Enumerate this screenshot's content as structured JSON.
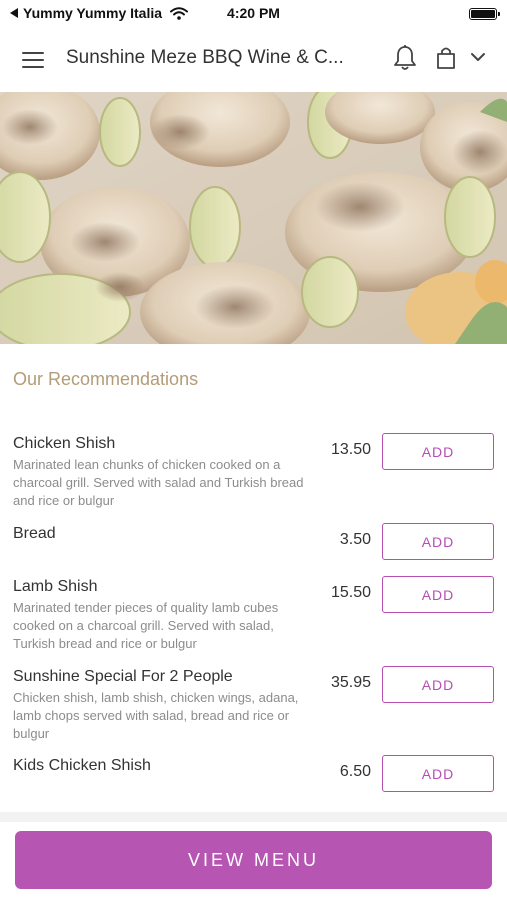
{
  "status_bar": {
    "back_label": "Yummy Yummy Italia",
    "time": "4:20 PM"
  },
  "header": {
    "title": "Sunshine Meze BBQ Wine & C..."
  },
  "section": {
    "title": "Our Recommendations"
  },
  "items": [
    {
      "name": "Chicken Shish",
      "description": "Marinated lean chunks of chicken cooked on a charcoal grill. Served with salad and Turkish bread and rice or bulgur",
      "price": "13.50",
      "add_label": "ADD"
    },
    {
      "name": "Bread",
      "description": "",
      "price": "3.50",
      "add_label": "ADD"
    },
    {
      "name": "Lamb Shish",
      "description": "Marinated tender pieces of quality lamb cubes cooked on a charcoal grill. Served with salad, Turkish bread and rice or bulgur",
      "price": "15.50",
      "add_label": "ADD"
    },
    {
      "name": "Sunshine Special For 2 People",
      "description": "Chicken shish, lamb shish, chicken wings, adana, lamb chops served with salad, bread and rice or bulgur",
      "price": "35.95",
      "add_label": "ADD"
    },
    {
      "name": "Kids Chicken Shish",
      "description": "",
      "price": "6.50",
      "add_label": "ADD"
    }
  ],
  "footer": {
    "view_menu_label": "VIEW MENU"
  },
  "colors": {
    "accent": "#b655b2",
    "section_title": "#b39c77",
    "description": "#8c8c8c"
  }
}
